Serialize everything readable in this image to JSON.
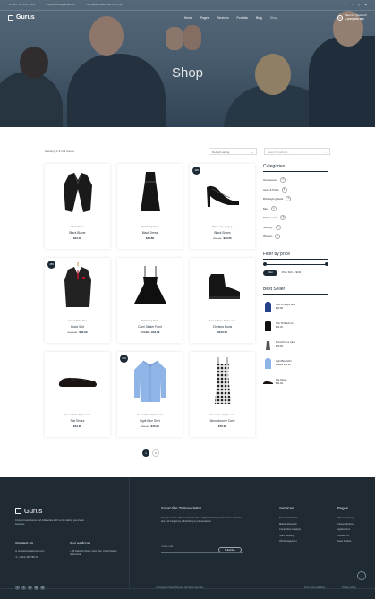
{
  "topbar": {
    "phone": "Mon - Fri: 9:00 - 18:00",
    "email": "gurusthemes@email.com",
    "address": "28 Market Street, New York, USA"
  },
  "header": {
    "logo": "Gurus",
    "menu": [
      "Home",
      "Pages",
      "Services",
      "Portfolio",
      "Blog",
      "Shop"
    ],
    "call_label": "Have Any Questions?",
    "call_number": "+(123) 456-789"
  },
  "hero": {
    "title": "Shop"
  },
  "shop": {
    "results": "Showing 1–9 of 9 results",
    "sort_placeholder": "Default sorting",
    "search_placeholder": "Search products..."
  },
  "products": [
    {
      "cat": "Men's Shoes",
      "name": "Black Blazer",
      "old": "",
      "price": "$24.00",
      "badge": ""
    },
    {
      "cat": "Bricklaying Tools",
      "name": "Black Dress",
      "old": "",
      "price": "$43.89",
      "badge": ""
    },
    {
      "cat": "Bell Levels, Surgery",
      "name": "Black Shoes",
      "old": "$52.00",
      "price": "$30.65",
      "badge": "-40%"
    },
    {
      "cat": "Axes & Picks, Men",
      "name": "Black Suit",
      "old": "$125.80",
      "price": "$83.99",
      "badge": "-35%"
    },
    {
      "cat": "Bricklaying Tools",
      "name": "Cami Skater Front",
      "old": "",
      "price": "$14.99 – $54.99",
      "badge": ""
    },
    {
      "cat": "Axes & Picks, Spirit Levels",
      "name": "Chelsea Boots",
      "old": "",
      "price": "$120.00",
      "badge": ""
    },
    {
      "cat": "Axes & Picks, Spirit Levels",
      "name": "Flat Shoes",
      "old": "",
      "price": "$34.99",
      "badge": ""
    },
    {
      "cat": "Axes & Picks, Spirit Levels",
      "name": "Light Blue Shirt",
      "old": "$99.00",
      "price": "$45.99",
      "badge": "-54%"
    },
    {
      "cat": "Accessories, Spirit Levels",
      "name": "Monochrome Cami",
      "old": "",
      "price": "$70.99",
      "badge": ""
    }
  ],
  "pagination": [
    "1",
    "2"
  ],
  "sidebar": {
    "categories_title": "Categories",
    "categories": [
      {
        "name": "Accessories",
        "count": "3"
      },
      {
        "name": "Axes & Picks",
        "count": "4"
      },
      {
        "name": "Bricklaying Tools",
        "count": "2"
      },
      {
        "name": "Men",
        "count": "1"
      },
      {
        "name": "Spirit Levels",
        "count": "5"
      },
      {
        "name": "Surgery",
        "count": "1"
      },
      {
        "name": "Women",
        "count": "3"
      }
    ],
    "filter_title": "Filter by price",
    "filter_button": "Filter",
    "price_range": "Price: $10 — $130",
    "best_title": "Best Seller",
    "best": [
      {
        "name": "Slim Fit Bright Blue",
        "old": "",
        "price": "$43.98"
      },
      {
        "name": "Slim Fit Black Co",
        "old": "",
        "price": "$54.00"
      },
      {
        "name": "Monochrome Cami",
        "old": "",
        "price": "$70.99"
      },
      {
        "name": "Light Blue Shirt",
        "old": "$99.00",
        "price": "$45.99"
      },
      {
        "name": "Flat Shoes",
        "old": "",
        "price": "$34.99"
      }
    ]
  },
  "footer": {
    "logo": "Gurus",
    "about": "Connect team Gurus and collaborate with us for making you dream business",
    "contact_title": "Contact us",
    "contact_email": "gurusthemes@email.com",
    "contact_phone": "+(123) 456-789 11",
    "address_title": "Our address",
    "address": "28 Valencia Street, New York, United States of America",
    "newsletter_title": "Subscribe To Newsletter",
    "newsletter_text": "Stay up-to-date with the latest trends in digital marketing and receive exclusive tips and insights by subscribing to our newsletter.",
    "email_placeholder": "Your e-mail",
    "subscribe_label": "Subscribe",
    "services_title": "Services",
    "services": [
      "Financial Analysis",
      "Market Research",
      "Competitive Analysis",
      "Team Building",
      "HR Management"
    ],
    "pages_title": "Pages",
    "pages": [
      "About Company",
      "Career Options",
      "Applications",
      "Contact Us",
      "Case Studies"
    ],
    "copyright": "© Copyright SoaroThemes. All rights reserved.",
    "terms": "Term and conditions",
    "privacy": "Privacy policy",
    "social": [
      "f",
      "t",
      "in",
      "ig",
      "yt"
    ]
  }
}
